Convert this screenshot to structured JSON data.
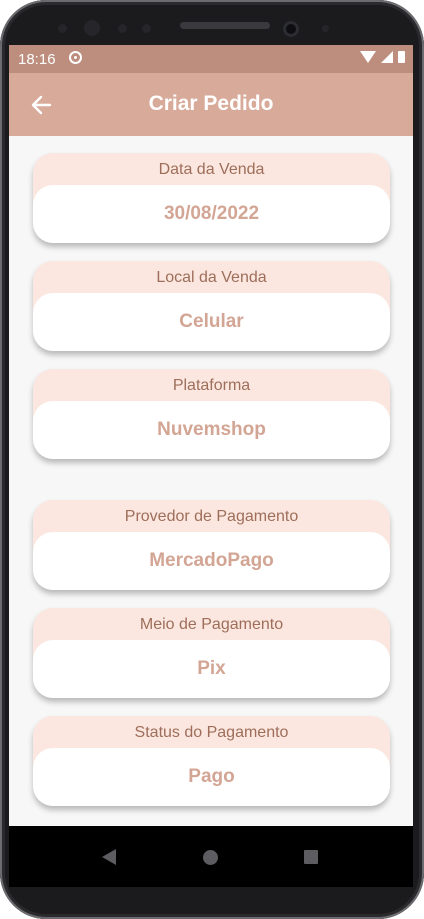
{
  "status_bar": {
    "time": "18:16"
  },
  "app_bar": {
    "title": "Criar Pedido",
    "back_icon": "arrow-left-icon"
  },
  "fields": [
    {
      "label": "Data da Venda",
      "value": "30/08/2022"
    },
    {
      "label": "Local da Venda",
      "value": "Celular"
    },
    {
      "label": "Plataforma",
      "value": "Nuvemshop"
    },
    {
      "label": "Provedor de Pagamento",
      "value": "MercadoPago"
    },
    {
      "label": "Meio de Pagamento",
      "value": "Pix"
    },
    {
      "label": "Status do Pagamento",
      "value": "Pago"
    }
  ],
  "colors": {
    "app_bar": "#d8aa9a",
    "status_bar": "#bd8e7e",
    "field_header": "#fbe7df",
    "field_label": "#9e6e5a",
    "field_value": "#d3a594"
  },
  "nav_bar": {
    "icons": [
      "back-triangle-icon",
      "home-circle-icon",
      "recents-square-icon"
    ]
  }
}
